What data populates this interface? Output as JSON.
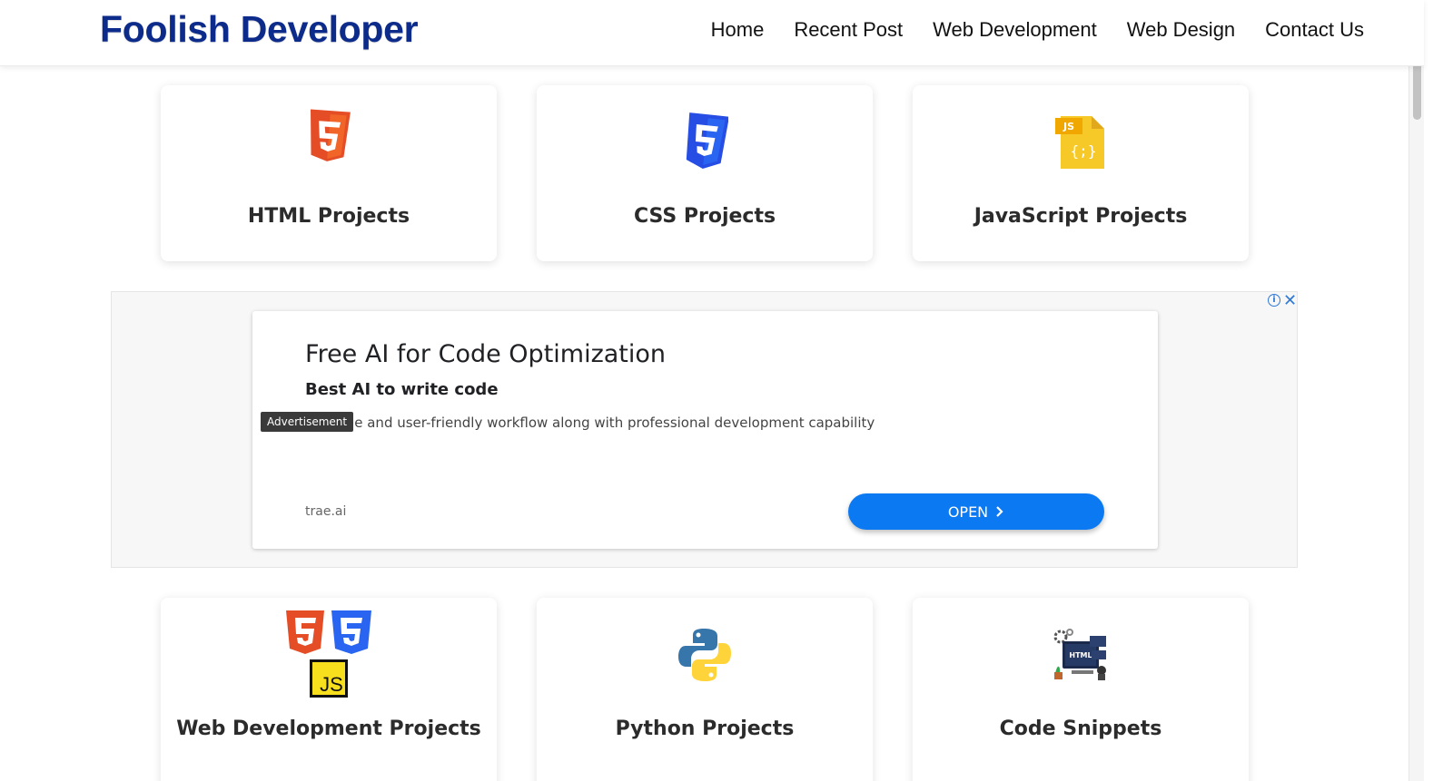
{
  "header": {
    "logo": "Foolish Developer",
    "nav": [
      "Home",
      "Recent Post",
      "Web Development",
      "Web Design",
      "Contact Us"
    ]
  },
  "cards": [
    {
      "label": "HTML Projects",
      "icon": "html5-icon"
    },
    {
      "label": "CSS Projects",
      "icon": "css3-icon"
    },
    {
      "label": "JavaScript Projects",
      "icon": "javascript-file-icon"
    },
    {
      "label": "Web Development Projects",
      "icon": "html-css-js-icon"
    },
    {
      "label": "Python Projects",
      "icon": "python-icon"
    },
    {
      "label": "Code Snippets",
      "icon": "code-snippets-icon"
    }
  ],
  "ad": {
    "title": "Free AI for Code Optimization",
    "subtitle": "Best AI to write code",
    "body": "a simple and user-friendly workflow along with professional development capability",
    "badge": "Advertisement",
    "domain": "trae.ai",
    "button": "OPEN",
    "info_icon": "i",
    "close_icon": "✕"
  },
  "icon_text": {
    "js_badge": "JS",
    "js_braces": "{;}",
    "html_screen": "HTML"
  },
  "colors": {
    "logo": "#0c2b8a",
    "html_orange": "#e44d26",
    "css_blue": "#264de4",
    "js_yellow": "#f7df1e",
    "ad_button": "#0b79f2"
  }
}
